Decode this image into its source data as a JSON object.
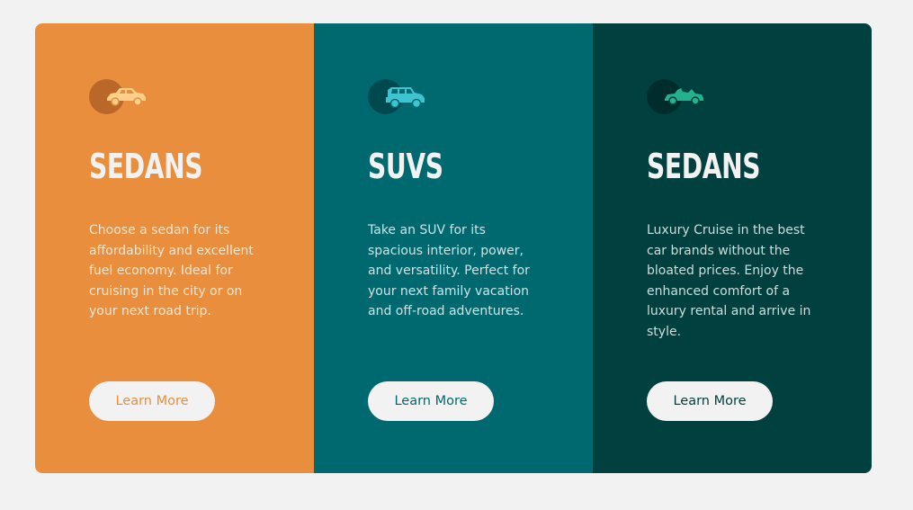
{
  "cards": [
    {
      "icon": "sedan-car-icon",
      "title": "SEDANS",
      "text": "Choose a sedan for its affordability and excellent fuel economy. Ideal for cruising in the city or on your next road trip.",
      "button_label": "Learn More",
      "color": "#e98e3c"
    },
    {
      "icon": "suv-car-icon",
      "title": "SUVS",
      "text": "Take an SUV for its spacious interior, power, and versatility. Perfect for your next family vacation and off-road adventures.",
      "button_label": "Learn More",
      "color": "#006970"
    },
    {
      "icon": "luxury-car-icon",
      "title": "SEDANS",
      "text": "Luxury Cruise in the best car brands without the bloated prices. Enjoy the enhanced comfort of a luxury rental and arrive in style.",
      "button_label": "Learn More",
      "color": "#00403f"
    }
  ],
  "colors": {
    "background": "#f2f2f2",
    "orange": "#e98e3c",
    "teal": "#006970",
    "dark_cyan": "#00403f",
    "icon_yellow": "#ffd08a",
    "icon_cyan": "#3cc4d0",
    "icon_green": "#23b28c"
  }
}
